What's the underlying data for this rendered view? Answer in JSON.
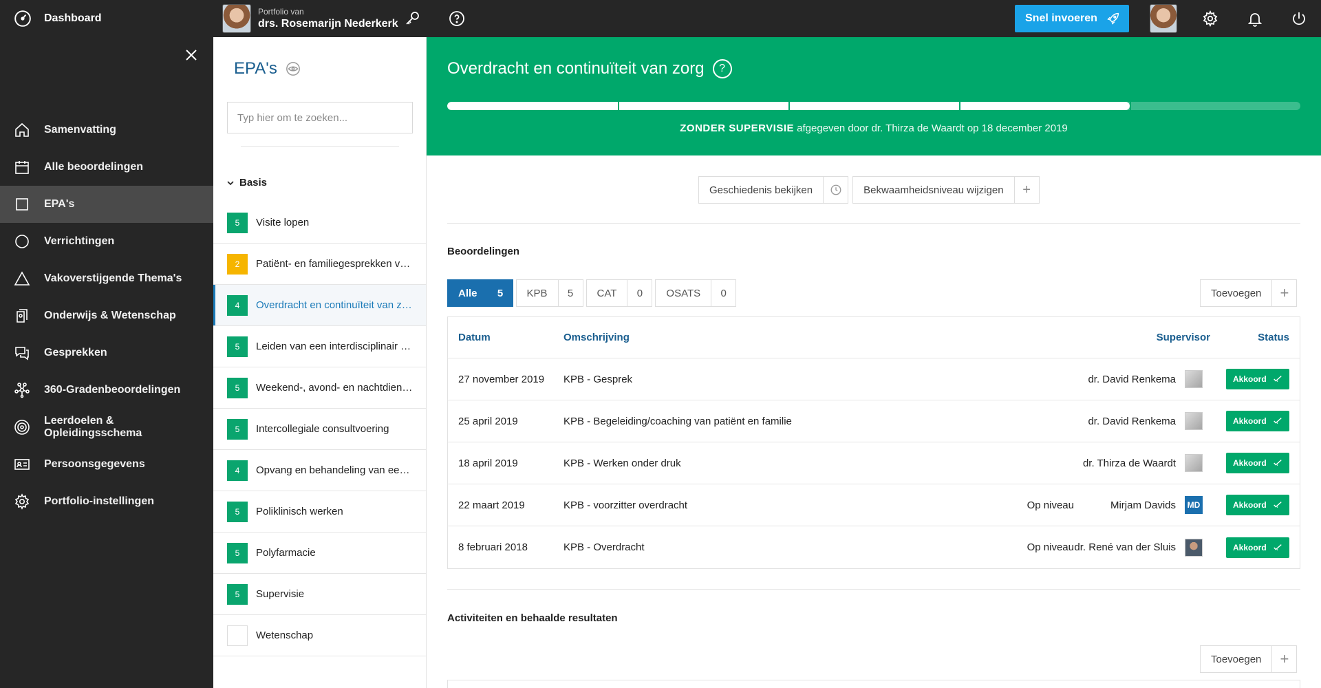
{
  "topbar": {
    "dashboard": "Dashboard",
    "portfolio_of": "Portfolio van",
    "portfolio_name": "drs. Rosemarijn Nederkerk",
    "snel_invoeren": "Snel invoeren"
  },
  "sidebar": {
    "items": [
      {
        "label": "Samenvatting",
        "icon": "home-icon"
      },
      {
        "label": "Alle beoordelingen",
        "icon": "calendar-icon"
      },
      {
        "label": "EPA's",
        "icon": "square-icon",
        "active": true
      },
      {
        "label": "Verrichtingen",
        "icon": "circle-icon"
      },
      {
        "label": "Vakoverstijgende Thema's",
        "icon": "triangle-icon"
      },
      {
        "label": "Onderwijs & Wetenschap",
        "icon": "book-icon"
      },
      {
        "label": "Gesprekken",
        "icon": "chat-icon"
      },
      {
        "label": "360-Gradenbeoordelingen",
        "icon": "network-icon"
      },
      {
        "label": "Leerdoelen & Opleidingsschema",
        "icon": "target-icon"
      },
      {
        "label": "Persoonsgegevens",
        "icon": "id-card-icon"
      },
      {
        "label": "Portfolio-instellingen",
        "icon": "gear-icon"
      }
    ]
  },
  "epa_panel": {
    "title": "EPA's",
    "search_placeholder": "Typ hier om te zoeken...",
    "group": "Basis",
    "items": [
      {
        "level": "5",
        "label": "Visite lopen",
        "color": "green"
      },
      {
        "level": "2",
        "label": "Patiënt- en familiegesprekken voeren",
        "color": "yellow"
      },
      {
        "level": "4",
        "label": "Overdracht en continuïteit van zorg",
        "color": "green",
        "active": true
      },
      {
        "level": "5",
        "label": "Leiden van een interdisciplinair overleg",
        "color": "green"
      },
      {
        "level": "5",
        "label": "Weekend-, avond- en nachtdiensten",
        "color": "green"
      },
      {
        "level": "5",
        "label": "Intercollegiale consultvoering",
        "color": "green"
      },
      {
        "level": "4",
        "label": "Opvang en behandeling van een acuut zieke patiënt",
        "color": "green"
      },
      {
        "level": "5",
        "label": "Poliklinisch werken",
        "color": "green"
      },
      {
        "level": "5",
        "label": "Polyfarmacie",
        "color": "green"
      },
      {
        "level": "5",
        "label": "Supervisie",
        "color": "green"
      },
      {
        "level": "",
        "label": "Wetenschap",
        "color": "empty"
      }
    ]
  },
  "main": {
    "title": "Overdracht en continuïteit van zorg",
    "progress_fraction": 0.8,
    "level_label": "ZONDER SUPERVISIE",
    "given_by": " afgegeven door dr. Thirza de Waardt op 18 december 2019",
    "history_button": "Geschiedenis bekijken",
    "change_level_button": "Bekwaamheidsniveau wijzigen",
    "beoordelingen_title": "Beoordelingen",
    "filters": [
      {
        "label": "Alle",
        "count": "5",
        "active": true
      },
      {
        "label": "KPB",
        "count": "5"
      },
      {
        "label": "CAT",
        "count": "0"
      },
      {
        "label": "OSATS",
        "count": "0"
      }
    ],
    "add_label": "Toevoegen",
    "table": {
      "headers": {
        "date": "Datum",
        "description": "Omschrijving",
        "supervisor": "Supervisor",
        "status": "Status"
      },
      "rows": [
        {
          "date": "27 november 2019",
          "description": "KPB - Gesprek",
          "level": "",
          "supervisor": "dr. David Renkema",
          "avatar": "grey",
          "status": "Akkoord"
        },
        {
          "date": "25 april 2019",
          "description": "KPB - Begeleiding/coaching van patiënt en familie",
          "level": "",
          "supervisor": "dr. David Renkema",
          "avatar": "grey",
          "status": "Akkoord"
        },
        {
          "date": "18 april 2019",
          "description": "KPB - Werken onder druk",
          "level": "",
          "supervisor": "dr. Thirza de Waardt",
          "avatar": "grey",
          "status": "Akkoord"
        },
        {
          "date": "22 maart 2019",
          "description": "KPB - voorzitter overdracht",
          "level": "Op niveau",
          "supervisor": "Mirjam Davids",
          "avatar": "MD",
          "status": "Akkoord"
        },
        {
          "date": "8 februari 2018",
          "description": "KPB - Overdracht",
          "level": "Op niveau",
          "supervisor": "dr. René van der Sluis",
          "avatar": "photo",
          "status": "Akkoord"
        }
      ]
    },
    "activities_title": "Activiteiten en behaalde resultaten",
    "add_label_2": "Toevoegen"
  }
}
